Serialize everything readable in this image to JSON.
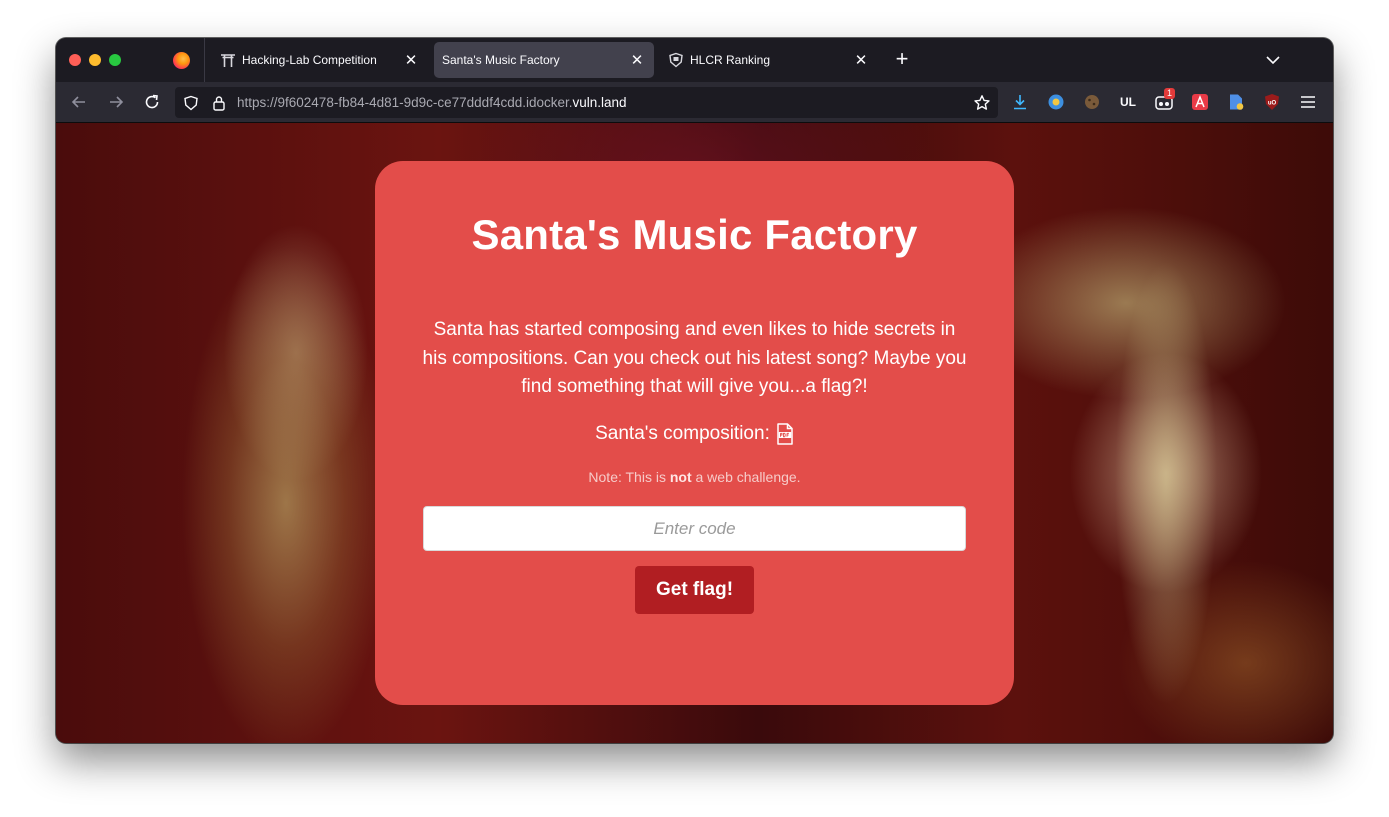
{
  "browser": {
    "tabs": [
      {
        "title": "Hacking-Lab Competition",
        "icon": "torii-gate-icon",
        "active": false
      },
      {
        "title": "Santa's Music Factory",
        "icon": "",
        "active": true
      },
      {
        "title": "HLCR Ranking",
        "icon": "shield-icon",
        "active": false
      }
    ],
    "url": {
      "prefix": "https://9f602478-fb84-4d81-9d9c-ce77dddf4cdd.idocker.",
      "domain": "vuln.land"
    },
    "extensions": {
      "ul_label": "UL",
      "notification_badge": "1"
    }
  },
  "page": {
    "title": "Santa's Music Factory",
    "description": "Santa has started composing and even likes to hide secrets in his compositions. Can you check out his latest song? Maybe you find something that will give you...a flag?!",
    "composition_label": "Santa's composition:",
    "note_prefix": "Note: This is ",
    "note_bold": "not",
    "note_suffix": " a web challenge.",
    "input_placeholder": "Enter code",
    "button_label": "Get flag!"
  },
  "colors": {
    "card": "#e34d4a",
    "button": "#b11e22",
    "browser_chrome": "#1c1b22",
    "active_tab": "#42414d"
  }
}
